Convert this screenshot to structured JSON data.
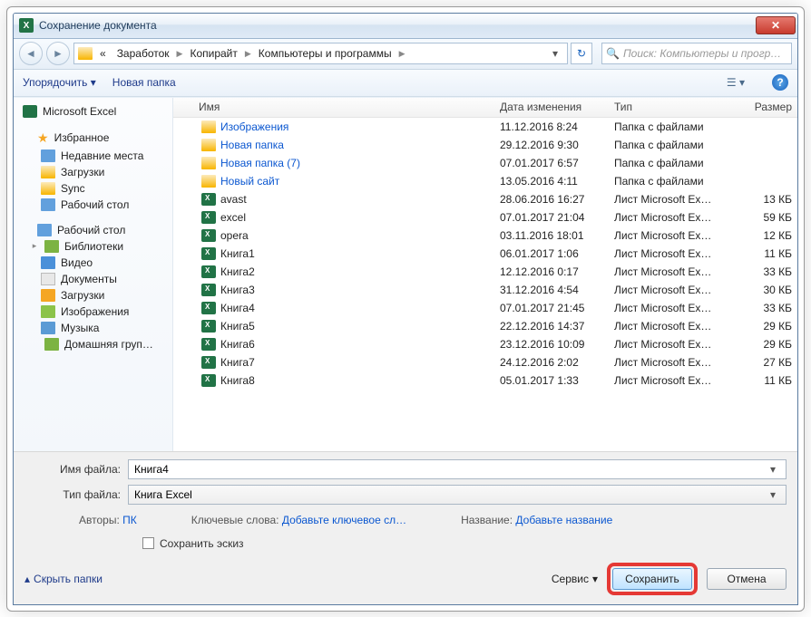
{
  "window": {
    "title": "Сохранение документа"
  },
  "breadcrumbs": {
    "chev": "«",
    "b1": "Заработок",
    "b2": "Копирайт",
    "b3": "Компьютеры и программы"
  },
  "search": {
    "placeholder": "Поиск: Компьютеры и прогр…"
  },
  "toolbar": {
    "organize": "Упорядочить",
    "newfolder": "Новая папка"
  },
  "sidebar": {
    "excel": "Microsoft Excel",
    "fav": "Избранное",
    "recent": "Недавние места",
    "downloads": "Загрузки",
    "sync": "Sync",
    "desktop": "Рабочий стол",
    "desktop2": "Рабочий стол",
    "libraries": "Библиотеки",
    "video": "Видео",
    "docs": "Документы",
    "down2": "Загрузки",
    "images": "Изображения",
    "music": "Музыка",
    "home": "Домашняя груп…"
  },
  "columns": {
    "name": "Имя",
    "date": "Дата изменения",
    "type": "Тип",
    "size": "Размер"
  },
  "files": [
    {
      "name": "Изображения",
      "date": "11.12.2016 8:24",
      "type": "Папка с файлами",
      "size": "",
      "kind": "folder",
      "link": true
    },
    {
      "name": "Новая папка",
      "date": "29.12.2016 9:30",
      "type": "Папка с файлами",
      "size": "",
      "kind": "folder",
      "link": true
    },
    {
      "name": "Новая папка (7)",
      "date": "07.01.2017 6:57",
      "type": "Папка с файлами",
      "size": "",
      "kind": "folder",
      "link": true
    },
    {
      "name": "Новый сайт",
      "date": "13.05.2016 4:11",
      "type": "Папка с файлами",
      "size": "",
      "kind": "folder",
      "link": true
    },
    {
      "name": "avast",
      "date": "28.06.2016 16:27",
      "type": "Лист Microsoft Ex…",
      "size": "13 КБ",
      "kind": "excel"
    },
    {
      "name": "excel",
      "date": "07.01.2017 21:04",
      "type": "Лист Microsoft Ex…",
      "size": "59 КБ",
      "kind": "excel"
    },
    {
      "name": "opera",
      "date": "03.11.2016 18:01",
      "type": "Лист Microsoft Ex…",
      "size": "12 КБ",
      "kind": "excel"
    },
    {
      "name": "Книга1",
      "date": "06.01.2017 1:06",
      "type": "Лист Microsoft Ex…",
      "size": "11 КБ",
      "kind": "excel"
    },
    {
      "name": "Книга2",
      "date": "12.12.2016 0:17",
      "type": "Лист Microsoft Ex…",
      "size": "33 КБ",
      "kind": "excel"
    },
    {
      "name": "Книга3",
      "date": "31.12.2016 4:54",
      "type": "Лист Microsoft Ex…",
      "size": "30 КБ",
      "kind": "excel"
    },
    {
      "name": "Книга4",
      "date": "07.01.2017 21:45",
      "type": "Лист Microsoft Ex…",
      "size": "33 КБ",
      "kind": "excel"
    },
    {
      "name": "Книга5",
      "date": "22.12.2016 14:37",
      "type": "Лист Microsoft Ex…",
      "size": "29 КБ",
      "kind": "excel"
    },
    {
      "name": "Книга6",
      "date": "23.12.2016 10:09",
      "type": "Лист Microsoft Ex…",
      "size": "29 КБ",
      "kind": "excel"
    },
    {
      "name": "Книга7",
      "date": "24.12.2016 2:02",
      "type": "Лист Microsoft Ex…",
      "size": "27 КБ",
      "kind": "excel"
    },
    {
      "name": "Книга8",
      "date": "05.01.2017 1:33",
      "type": "Лист Microsoft Ex…",
      "size": "11 КБ",
      "kind": "excel"
    }
  ],
  "form": {
    "filename_label": "Имя файла:",
    "filename_value": "Книга4",
    "filetype_label": "Тип файла:",
    "filetype_value": "Книга Excel",
    "authors_label": "Авторы:",
    "authors_value": "ПК",
    "keywords_label": "Ключевые слова:",
    "keywords_value": "Добавьте ключевое сл…",
    "title_label": "Название:",
    "title_value": "Добавьте название",
    "thumb": "Сохранить эскиз",
    "hide": "Скрыть папки",
    "service": "Сервис",
    "save": "Сохранить",
    "cancel": "Отмена"
  }
}
